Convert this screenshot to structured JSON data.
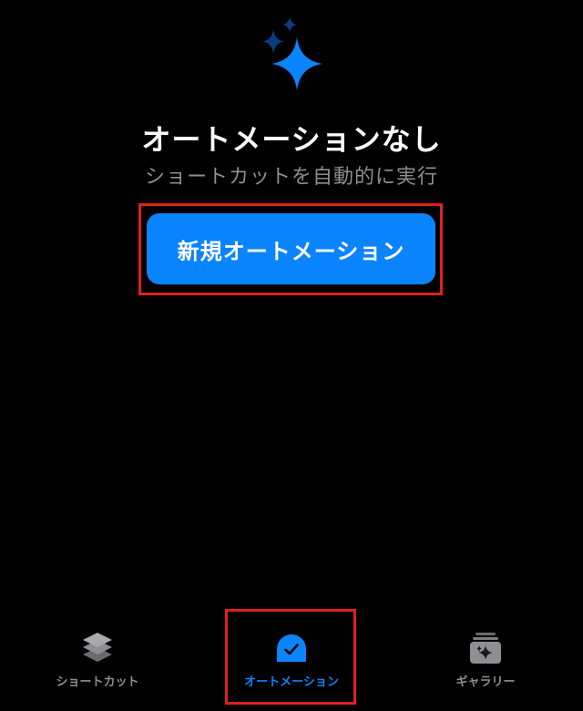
{
  "empty_state": {
    "icon": "sparkles-icon",
    "title": "オートメーションなし",
    "subtitle": "ショートカットを自動的に実行"
  },
  "new_automation_button": {
    "label": "新規オートメーション"
  },
  "tab_bar": {
    "tabs": [
      {
        "label": "ショートカット",
        "icon": "layers-icon",
        "selected": false
      },
      {
        "label": "オートメーション",
        "icon": "clock-icon",
        "selected": true
      },
      {
        "label": "ギャラリー",
        "icon": "gallery-stack-icon",
        "selected": false
      }
    ]
  },
  "colors": {
    "background": "#000000",
    "accent": "#0a84ff",
    "accent_dark": "#0a3d80",
    "secondary_text": "#8d8d93",
    "inactive_icon": "#8e8e93",
    "annotation": "#e0201c"
  }
}
